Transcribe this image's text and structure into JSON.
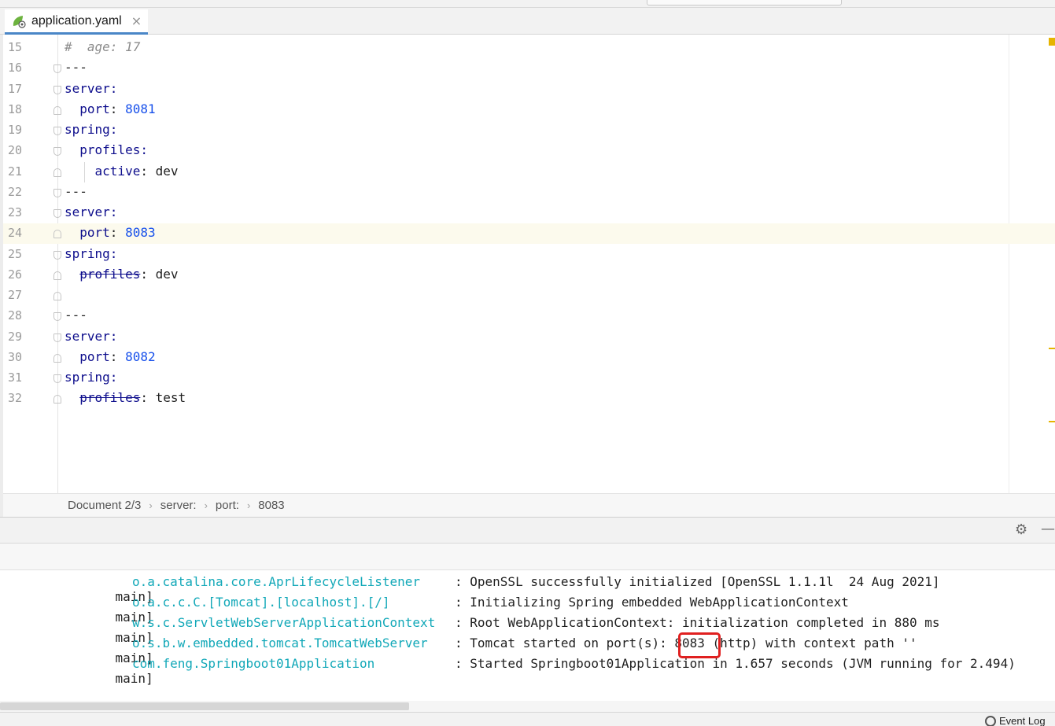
{
  "tab": {
    "title": "application.yaml",
    "close": "×"
  },
  "editor": {
    "lines": [
      {
        "no": "15",
        "text": "#  age: 17"
      },
      {
        "no": "16",
        "text": "---"
      },
      {
        "no": "17",
        "text": "server:"
      },
      {
        "no": "18",
        "text": "  port: 8081"
      },
      {
        "no": "19",
        "text": "spring:"
      },
      {
        "no": "20",
        "text": "  profiles:"
      },
      {
        "no": "21",
        "text": "    active: dev"
      },
      {
        "no": "22",
        "text": "---"
      },
      {
        "no": "23",
        "text": "server:"
      },
      {
        "no": "24",
        "text": "  port: 8083",
        "current": true
      },
      {
        "no": "25",
        "text": "spring:"
      },
      {
        "no": "26",
        "text": "  profiles: dev",
        "deprecated": true
      },
      {
        "no": "27",
        "text": ""
      },
      {
        "no": "28",
        "text": "---"
      },
      {
        "no": "29",
        "text": "server:"
      },
      {
        "no": "30",
        "text": "  port: 8082"
      },
      {
        "no": "31",
        "text": "spring:"
      },
      {
        "no": "32",
        "text": "  profiles: test",
        "deprecated": true
      }
    ]
  },
  "breadcrumb": [
    "Document 2/3",
    "server:",
    "port:",
    "8083"
  ],
  "console": {
    "lines": [
      {
        "thread": "main]",
        "logger": "o.a.catalina.core.AprLifecycleListener  ",
        "message": ": OpenSSL successfully initialized [OpenSSL 1.1.1l  24 Aug 2021]"
      },
      {
        "thread": "main]",
        "logger": "o.a.c.c.C.[Tomcat].[localhost].[/]      ",
        "message": ": Initializing Spring embedded WebApplicationContext"
      },
      {
        "thread": "main]",
        "logger": "w.s.c.ServletWebServerApplicationContext",
        "message": ": Root WebApplicationContext: initialization completed in 880 ms"
      },
      {
        "thread": "main]",
        "logger": "o.s.b.w.embedded.tomcat.TomcatWebServer ",
        "message": ": Tomcat started on port(s): 8083 (http) with context path ''"
      },
      {
        "thread": "main]",
        "logger": "com.feng.Springboot01Application        ",
        "message": ": Started Springboot01Application in 1.657 seconds (JVM running for 2.494)"
      }
    ]
  },
  "status": {
    "event_log": "Event Log"
  },
  "colors": {
    "keyword": "#0d0d8c",
    "number": "#1750eb",
    "logger": "#12a8b8",
    "highlight": "#e02020"
  }
}
